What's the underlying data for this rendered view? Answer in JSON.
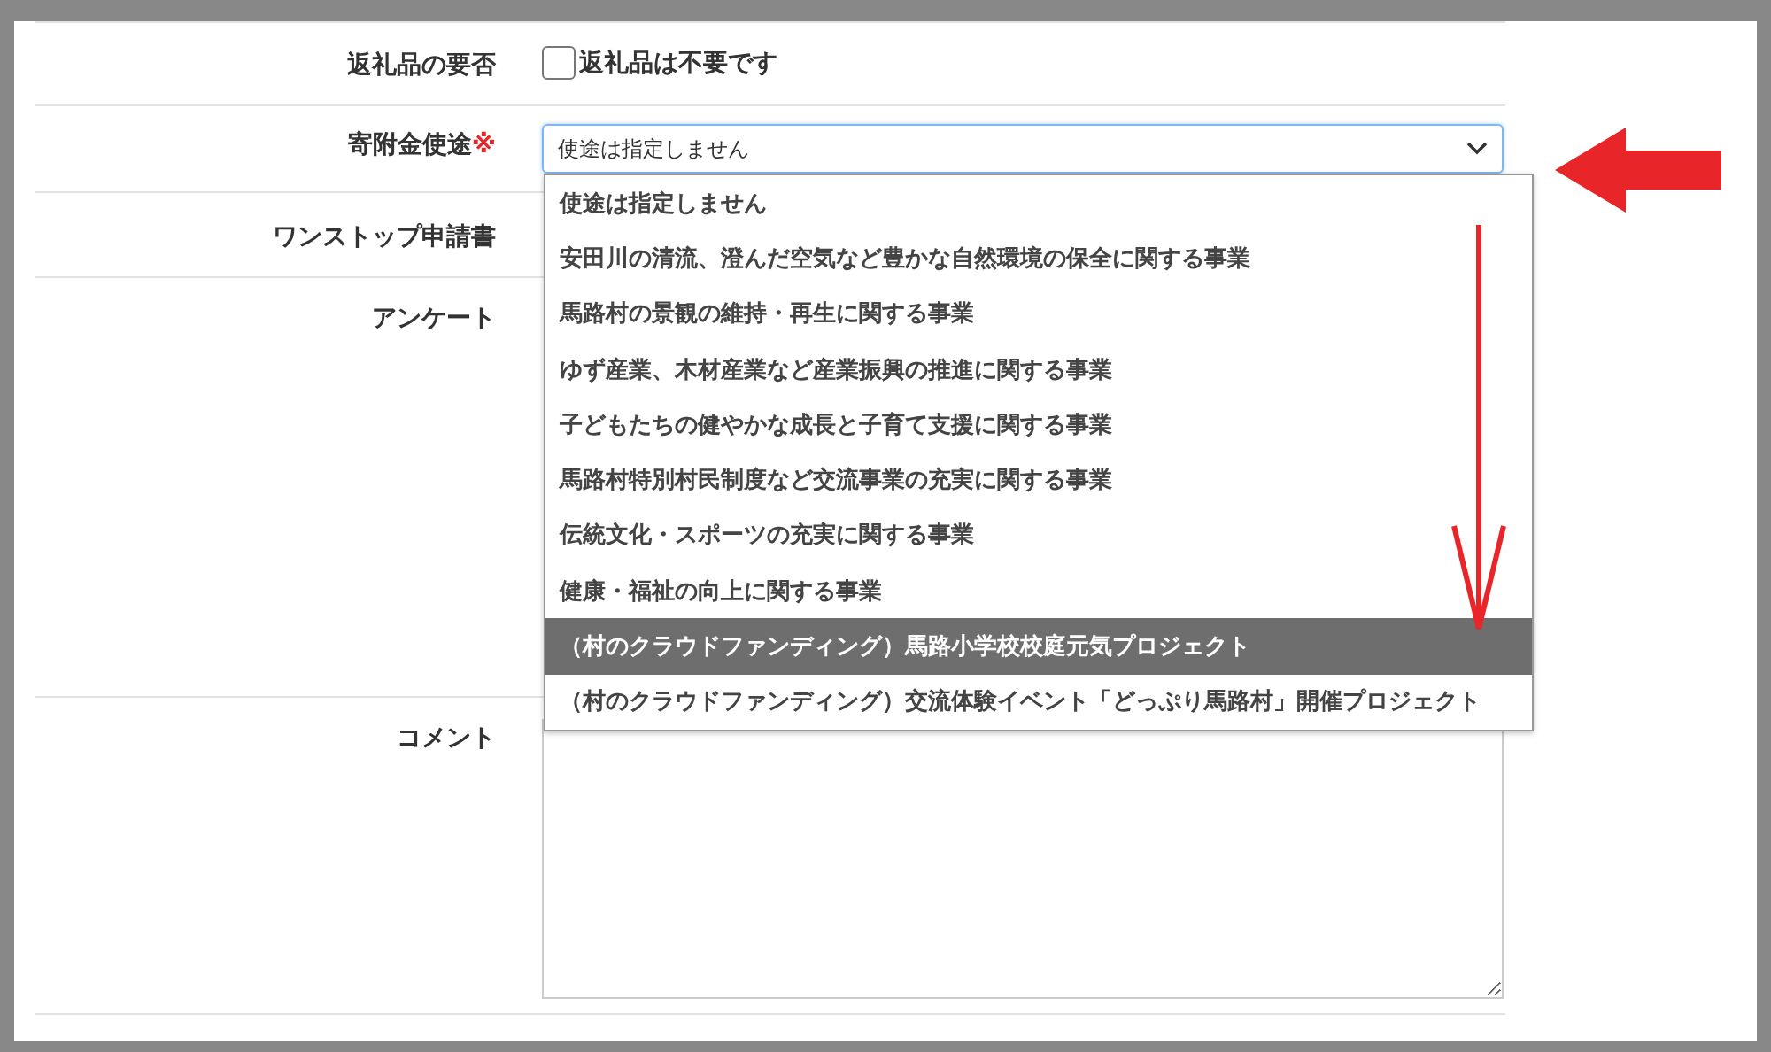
{
  "rows": [
    {
      "kind": "checkbox",
      "label": "返礼品の要否",
      "checkbox": {
        "label": "返礼品は不要です",
        "checked": false
      }
    },
    {
      "kind": "select",
      "label": "寄附金使途",
      "required_mark": "※",
      "select": {
        "value": "使途は指定しません",
        "expanded": true,
        "options": [
          {
            "label": "使途は指定しません",
            "highlighted": false
          },
          {
            "label": "安田川の清流、澄んだ空気など豊かな自然環境の保全に関する事業",
            "highlighted": false
          },
          {
            "label": "馬路村の景観の維持・再生に関する事業",
            "highlighted": false
          },
          {
            "label": "ゆず産業、木材産業など産業振興の推進に関する事業",
            "highlighted": false
          },
          {
            "label": "子どもたちの健やかな成長と子育て支援に関する事業",
            "highlighted": false
          },
          {
            "label": "馬路村特別村民制度など交流事業の充実に関する事業",
            "highlighted": false
          },
          {
            "label": "伝統文化・スポーツの充実に関する事業",
            "highlighted": false
          },
          {
            "label": "健康・福祉の向上に関する事業",
            "highlighted": false
          },
          {
            "label": "（村のクラウドファンディング）馬路小学校校庭元気プロジェクト",
            "highlighted": true
          },
          {
            "label": "（村のクラウドファンディング）交流体験イベント「どっぷり馬路村」開催プロジェクト",
            "highlighted": false
          }
        ]
      }
    },
    {
      "kind": "hidden",
      "label": "ワンストップ申請書"
    },
    {
      "kind": "survey",
      "label": "アンケート"
    },
    {
      "kind": "textarea",
      "label": "コメント"
    }
  ]
}
